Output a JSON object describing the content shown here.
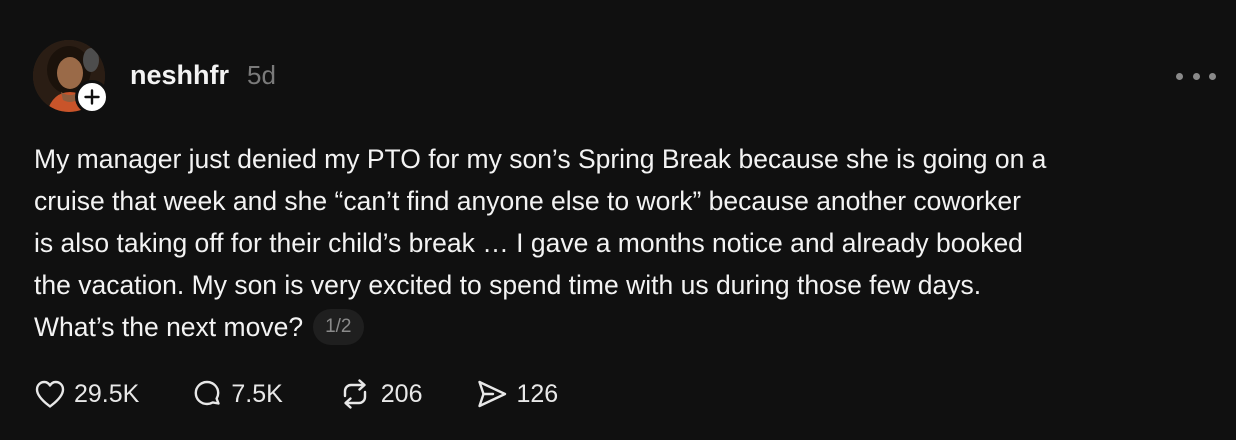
{
  "post": {
    "username": "neshhfr",
    "timestamp": "5d",
    "text_lines": [
      "My manager just denied my PTO for my son’s Spring Break because she is going on a",
      "cruise that week and she “can’t find anyone else to work” because another coworker",
      "is also taking off for their child’s break … I gave a months notice and already booked",
      "the vacation. My son is very excited to spend time with us during those few days.",
      "What’s the next move?"
    ],
    "page_indicator": "1/2"
  },
  "actions": {
    "likes": "29.5K",
    "replies": "7.5K",
    "reposts": "206",
    "shares": "126"
  },
  "icons": {
    "like": "heart-icon",
    "reply": "speech-bubble-icon",
    "repost": "repost-arrows-icon",
    "share": "send-icon",
    "more": "more-horizontal-icon",
    "follow": "plus-icon"
  },
  "colors": {
    "background": "#101010",
    "text": "#f3f3f3",
    "muted": "#7a7a7a"
  }
}
